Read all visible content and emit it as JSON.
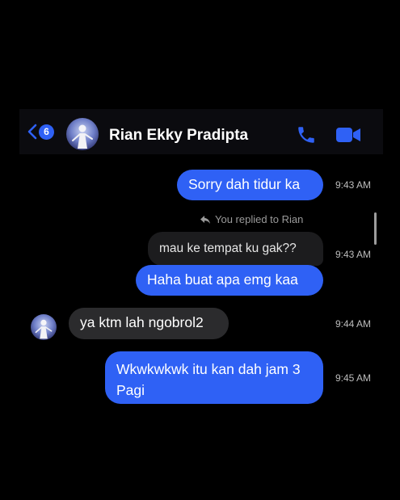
{
  "header": {
    "back_count": "6",
    "contact_name": "Rian Ekky Pradipta"
  },
  "thread": {
    "replied_label": "You replied to Rian",
    "messages": [
      {
        "text": "Sorry dah tidur ka",
        "time": "9:43 AM",
        "direction": "sent"
      },
      {
        "text": "mau ke tempat ku gak??",
        "time": "9:43 AM",
        "direction": "received-quoted"
      },
      {
        "text": "Haha buat apa emg kaa",
        "time": "",
        "direction": "sent"
      },
      {
        "text": "ya ktm lah ngobrol2",
        "time": "9:44 AM",
        "direction": "received"
      },
      {
        "text": "Wkwkwkwk itu kan dah jam 3  Pagi",
        "time": "9:45 AM",
        "direction": "sent"
      }
    ]
  },
  "colors": {
    "background": "#000000",
    "accent": "#2f61f5",
    "received_bubble": "#2b2b2d"
  },
  "icons": {
    "back": "chevron-left-icon",
    "call": "phone-icon",
    "video": "video-camera-icon",
    "reply": "reply-arrow-icon"
  }
}
